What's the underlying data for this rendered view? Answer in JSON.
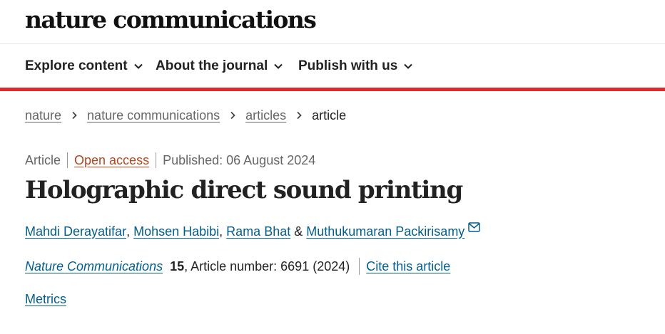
{
  "header": {
    "logo_text": "nature communications"
  },
  "nav": {
    "items": [
      {
        "label": "Explore content"
      },
      {
        "label": "About the journal"
      },
      {
        "label": "Publish with us"
      }
    ]
  },
  "breadcrumb": {
    "items": [
      "nature",
      "nature communications",
      "articles"
    ],
    "current": "article"
  },
  "article": {
    "type": "Article",
    "access": "Open access",
    "published": "Published: 06 August 2024",
    "title": "Holographic direct sound printing",
    "authors": [
      "Mahdi Derayatifar",
      "Mohsen Habibi",
      "Rama Bhat",
      "Muthukumaran Packirisamy"
    ],
    "author_sep_1": ", ",
    "author_sep_2": ", ",
    "author_sep_3": " & ",
    "journal": "Nature Communications",
    "volume": "15",
    "article_number": ", Article number: 6691 (2024)",
    "cite_label": "Cite this article",
    "metrics_label": "Metrics"
  },
  "colors": {
    "accent_red": "#e0282b",
    "link_blue": "#025e8d",
    "open_access_orange": "#b5451b"
  },
  "icons": [
    "chevron-down-icon",
    "chevron-right-icon",
    "envelope-icon"
  ]
}
